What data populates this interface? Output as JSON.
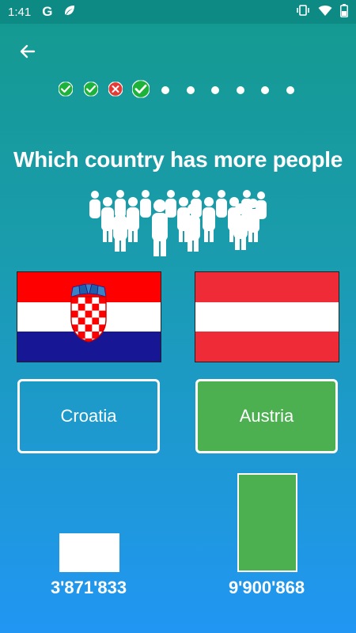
{
  "status_bar": {
    "time": "1:41",
    "google_letter": "G",
    "icons": [
      "leaf-icon",
      "vibrate-icon",
      "wifi-icon",
      "battery-icon"
    ]
  },
  "navigation": {
    "back_icon": "arrow-left-icon"
  },
  "progress": {
    "total": 10,
    "answered": [
      "correct",
      "correct",
      "wrong",
      "correct"
    ],
    "current_index": 3,
    "colors": {
      "correct": "#1db33b",
      "wrong": "#e53935",
      "pending": "#ffffff"
    }
  },
  "question": {
    "text": "Which country has more people",
    "icon": "crowd-icon"
  },
  "options": [
    {
      "country": "Croatia",
      "flag_colors": [
        "#ff0000",
        "#ffffff",
        "#171796"
      ],
      "population": "3'871'833",
      "population_value": 3871833,
      "result": "not-selected"
    },
    {
      "country": "Austria",
      "flag_colors": [
        "#ef2b38",
        "#ffffff",
        "#ef2b38"
      ],
      "population": "9'900'868",
      "population_value": 9900868,
      "result": "correct"
    }
  ],
  "colors": {
    "accent_green": "#4caf50",
    "background_top": "#14998f",
    "background_bottom": "#2196f3"
  }
}
